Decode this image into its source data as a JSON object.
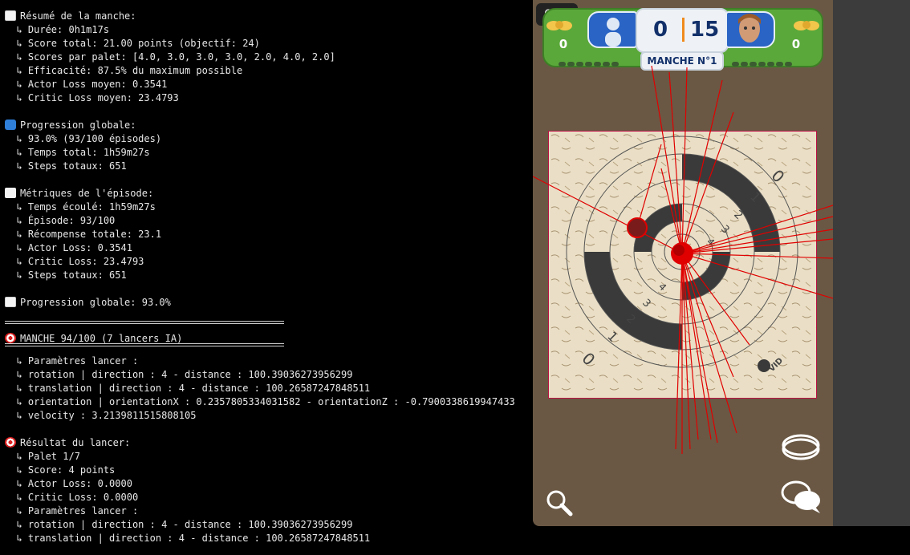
{
  "terminal": {
    "lines": [
      {
        "icon": "chart-increasing-icon",
        "text": "Résumé de la manche:"
      },
      {
        "text": "  ↳ Durée: 0h1m17s"
      },
      {
        "text": "  ↳ Score total: 21.00 points (objectif: 24)"
      },
      {
        "text": "  ↳ Scores par palet: [4.0, 3.0, 3.0, 3.0, 2.0, 4.0, 2.0]"
      },
      {
        "text": "  ↳ Efficacité: 87.5% du maximum possible"
      },
      {
        "text": "  ↳ Actor Loss moyen: 0.3541"
      },
      {
        "text": "  ↳ Critic Loss moyen: 23.4793"
      },
      {
        "text": ""
      },
      {
        "icon": "arrows-loop-icon",
        "text": "Progression globale:"
      },
      {
        "text": "  ↳ 93.0% (93/100 épisodes)"
      },
      {
        "text": "  ↳ Temps total: 1h59m27s"
      },
      {
        "text": "  ↳ Steps totaux: 651"
      },
      {
        "text": ""
      },
      {
        "icon": "bar-chart-icon",
        "text": "Métriques de l'épisode:"
      },
      {
        "text": "  ↳ Temps écoulé: 1h59m27s"
      },
      {
        "text": "  ↳ Épisode: 93/100"
      },
      {
        "text": "  ↳ Récompense totale: 23.1"
      },
      {
        "text": "  ↳ Actor Loss: 0.3541"
      },
      {
        "text": "  ↳ Critic Loss: 23.4793"
      },
      {
        "text": "  ↳ Steps totaux: 651"
      },
      {
        "text": ""
      },
      {
        "icon": "chart-increasing-icon",
        "text": "Progression globale: 93.0%"
      },
      {
        "text": ""
      },
      {
        "sep": true
      },
      {
        "icon": "direct-hit-icon",
        "text": "MANCHE 94/100 (7 lancers IA)"
      },
      {
        "sep": true
      },
      {
        "text": "  ↳ Paramètres lancer :"
      },
      {
        "text": "  ↳ rotation | direction : 4 - distance : 100.39036273956299"
      },
      {
        "text": "  ↳ translation | direction : 4 - distance : 100.26587247848511"
      },
      {
        "text": "  ↳ orientation | orientationX : 0.2357805334031582 - orientationZ : -0.7900338619947433"
      },
      {
        "text": "  ↳ velocity : 3.2139811515808105"
      },
      {
        "text": ""
      },
      {
        "icon": "direct-hit-icon",
        "text": "Résultat du lancer:"
      },
      {
        "text": "  ↳ Palet 1/7"
      },
      {
        "text": "  ↳ Score: 4 points"
      },
      {
        "text": "  ↳ Actor Loss: 0.0000"
      },
      {
        "text": "  ↳ Critic Loss: 0.0000"
      },
      {
        "text": "  ↳ Paramètres lancer :"
      },
      {
        "text": "  ↳ rotation | direction : 4 - distance : 100.39036273956299"
      },
      {
        "text": "  ↳ translation | direction : 4 - distance : 100.26587247848511"
      }
    ]
  },
  "game": {
    "fps": "60",
    "score_left": "0",
    "score_right": "15",
    "player1_points": "0",
    "player2_points": "0",
    "manche_label": "MANCHE N°1",
    "board_numbers": [
      "0",
      "1",
      "2",
      "3",
      "4",
      "4",
      "3",
      "2",
      "1",
      "0"
    ],
    "board_brand": "VID",
    "colors": {
      "felt_green": "#5aa83a",
      "player_blue": "#2a64c4",
      "score_navy": "#12306a",
      "throw_line": "#e00000",
      "wood": "#e9dcc2",
      "ring_dark": "#3a3a3a"
    }
  }
}
